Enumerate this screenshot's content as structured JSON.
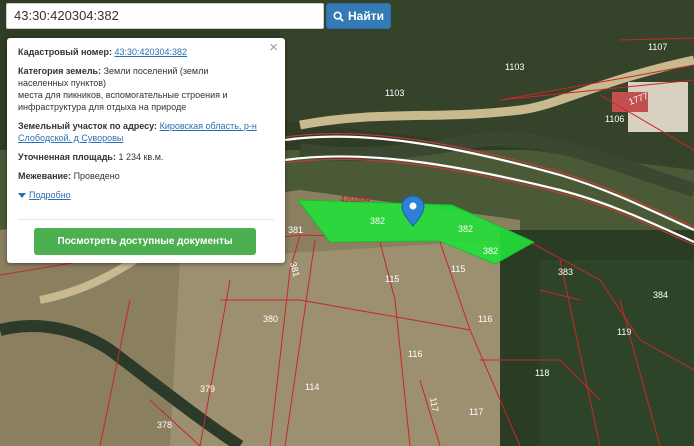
{
  "search": {
    "value": "43:30:420304:382",
    "button_label": "Найти"
  },
  "popup": {
    "cadastral_label": "Кадастровый номер:",
    "cadastral_value": "43:30:420304:382",
    "category_label": "Категория земель:",
    "category_value_line1": "Земли поселений (земли",
    "category_value_line2": "населенных пунктов)",
    "category_value_line3": "места для пикников, вспомогательные строения и",
    "category_value_line4": "инфраструктура для отдыха на природе",
    "address_label": "Земельный участок по адресу:",
    "address_line1": "Кировская область, р-н",
    "address_line2": "Слободской, д Суворовы",
    "area_label": "Уточненная площадь:",
    "area_value": "1 234 кв.м.",
    "survey_label": "Межевание:",
    "survey_value": "Проведено",
    "more_label": "Подробно",
    "docs_button": "Посмотреть доступные документы",
    "close_glyph": "×"
  },
  "map_labels": {
    "block": "420304",
    "p1107": "1107",
    "p1103a": "1103",
    "p1103b": "1103",
    "p1106": "1106",
    "p1777": "1777",
    "p382a": "382",
    "p382b": "382",
    "p382c": "382",
    "p381a": "381",
    "p381b": "381",
    "p383": "383",
    "p384": "384",
    "p115a": "115",
    "p115b": "115",
    "p116a": "116",
    "p116b": "116",
    "p119": "119",
    "p380": "380",
    "p114": "114",
    "p117a": "117",
    "p117b": "117",
    "p118": "118",
    "p379": "379",
    "p378": "378"
  },
  "colors": {
    "highlight": "#22e03a",
    "boundary": "#c62828",
    "button": "#4caf50",
    "search_button": "#337ab7"
  },
  "icons": [
    "search-icon",
    "close-icon",
    "chevron-down-icon",
    "map-marker-icon"
  ]
}
